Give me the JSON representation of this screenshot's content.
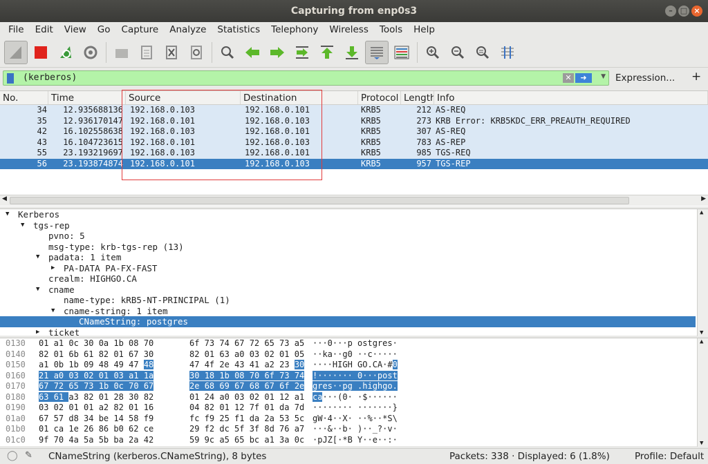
{
  "window": {
    "title": "Capturing from enp0s3"
  },
  "menu": [
    "File",
    "Edit",
    "View",
    "Go",
    "Capture",
    "Analyze",
    "Statistics",
    "Telephony",
    "Wireless",
    "Tools",
    "Help"
  ],
  "filter": {
    "value": "(kerberos)",
    "expression_label": "Expression...",
    "plus": "+"
  },
  "columns": [
    "No.",
    "Time",
    "Source",
    "Destination",
    "Protocol",
    "Length",
    "Info"
  ],
  "packets": [
    {
      "no": "34",
      "time": "12.935688136",
      "src": "192.168.0.103",
      "dst": "192.168.0.101",
      "proto": "KRB5",
      "len": "212",
      "info": "AS-REQ"
    },
    {
      "no": "35",
      "time": "12.936170147",
      "src": "192.168.0.101",
      "dst": "192.168.0.103",
      "proto": "KRB5",
      "len": "273",
      "info": "KRB Error: KRB5KDC_ERR_PREAUTH_REQUIRED"
    },
    {
      "no": "42",
      "time": "16.102558638",
      "src": "192.168.0.103",
      "dst": "192.168.0.101",
      "proto": "KRB5",
      "len": "307",
      "info": "AS-REQ"
    },
    {
      "no": "43",
      "time": "16.104723615",
      "src": "192.168.0.101",
      "dst": "192.168.0.103",
      "proto": "KRB5",
      "len": "783",
      "info": "AS-REP"
    },
    {
      "no": "55",
      "time": "23.193219697",
      "src": "192.168.0.103",
      "dst": "192.168.0.101",
      "proto": "KRB5",
      "len": "985",
      "info": "TGS-REQ"
    },
    {
      "no": "56",
      "time": "23.193874874",
      "src": "192.168.0.101",
      "dst": "192.168.0.103",
      "proto": "KRB5",
      "len": "957",
      "info": "TGS-REP"
    }
  ],
  "tree": [
    {
      "indent": 0,
      "arrow": "down",
      "text": "Kerberos"
    },
    {
      "indent": 1,
      "arrow": "down",
      "text": "tgs-rep"
    },
    {
      "indent": 2,
      "arrow": "",
      "text": "pvno: 5"
    },
    {
      "indent": 2,
      "arrow": "",
      "text": "msg-type: krb-tgs-rep (13)"
    },
    {
      "indent": 2,
      "arrow": "down",
      "text": "padata: 1 item"
    },
    {
      "indent": 3,
      "arrow": "right",
      "text": "PA-DATA PA-FX-FAST"
    },
    {
      "indent": 2,
      "arrow": "",
      "text": "crealm: HIGHGO.CA"
    },
    {
      "indent": 2,
      "arrow": "down",
      "text": "cname"
    },
    {
      "indent": 3,
      "arrow": "",
      "text": "name-type: kRB5-NT-PRINCIPAL (1)"
    },
    {
      "indent": 3,
      "arrow": "down",
      "text": "cname-string: 1 item"
    },
    {
      "indent": 4,
      "arrow": "",
      "text": "CNameString: postgres",
      "selected": true
    },
    {
      "indent": 2,
      "arrow": "right",
      "text": "ticket"
    }
  ],
  "hex": [
    {
      "off": "0130",
      "a": "01 a1 0c 30 0a 1b 08 70",
      "b": "6f 73 74 67 72 65 73 a5",
      "asc": "···0···p ostgres·"
    },
    {
      "off": "0140",
      "a": "82 01 6b 61 82 01 67 30",
      "b": "82 01 63 a0 03 02 01 05",
      "asc": "··ka··g0 ··c·····"
    },
    {
      "off": "0150",
      "a": "a1 0b 1b 09 48 49 47 48",
      "b": "47 4f 2e 43 41 a2 23 30",
      "asc": "····HIGH GO.CA·#0"
    },
    {
      "off": "0160",
      "a": "21 a0 03 02 01 03 a1 1a",
      "b": "30 18 1b 08 70 6f 73 74",
      "asc": "!······· 0···post"
    },
    {
      "off": "0170",
      "a": "67 72 65 73 1b 0c 70 67",
      "b": "2e 68 69 67 68 67 6f 2e",
      "asc": "gres··pg .highgo."
    },
    {
      "off": "0180",
      "a": "63 61 a3 82 01 28 30 82",
      "b": "01 24 a0 03 02 01 12 a1",
      "asc": "ca···(0· ·$······"
    },
    {
      "off": "0190",
      "a": "03 02 01 01 a2 82 01 16",
      "b": "04 82 01 12 7f 01 da 7d",
      "asc": "········ ·······}"
    },
    {
      "off": "01a0",
      "a": "67 57 d8 34 be 14 58 f9",
      "b": "fc f9 25 f1 da 2a 53 5c",
      "asc": "gW·4··X· ··%··*S\\"
    },
    {
      "off": "01b0",
      "a": "01 ca 1e 26 86 b0 62 ce",
      "b": "29 f2 dc 5f 3f 8d 76 a7",
      "asc": "···&··b· )··_?·v·"
    },
    {
      "off": "01c0",
      "a": "9f 70 4a 5a 5b ba 2a 42",
      "b": "59 9c a5 65 bc a1 3a 0c",
      "asc": "·pJZ[·*B Y··e··:·"
    }
  ],
  "status": {
    "field": "CNameString (kerberos.CNameString), 8 bytes",
    "packets": "Packets: 338 · Displayed: 6 (1.8%)",
    "profile": "Profile: Default"
  },
  "colors": {
    "selection": "#3a7fc1",
    "filter_bg": "#b4f3a8",
    "row_bg": "#dbe8f5",
    "annotation": "#e23b3b"
  }
}
